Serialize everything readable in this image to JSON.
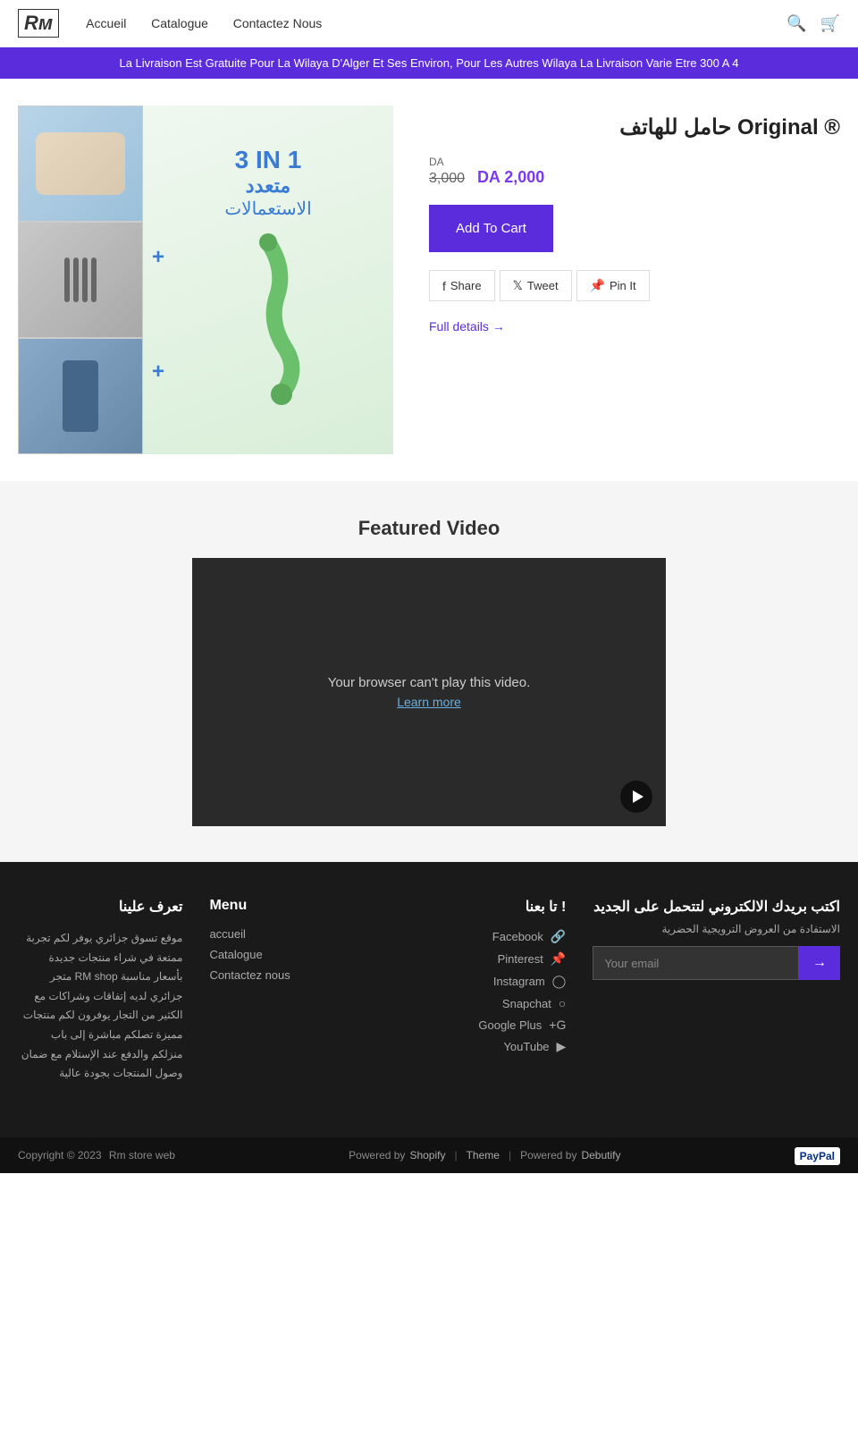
{
  "header": {
    "logo": "Rм",
    "nav": [
      {
        "label": "Accueil",
        "href": "#"
      },
      {
        "label": "Catalogue",
        "href": "#"
      },
      {
        "label": "Contactez Nous",
        "href": "#"
      }
    ]
  },
  "announcement": {
    "text": "La Livraison Est Gratuite Pour La Wilaya D'Alger Et Ses Environ, Pour Les Autres Wilaya La Livraison Varie Etre 300 A 4"
  },
  "product": {
    "title": "® Original حامل للهاتف",
    "currency_label": "DA",
    "original_price": "3,000",
    "sale_price": "DA 2,000",
    "add_to_cart_label": "Add To Cart",
    "full_details_label": "Full details →",
    "share_label": "Share",
    "tweet_label": "Tweet",
    "pin_label": "Pin It",
    "image_text_3in1": "3 IN 1",
    "image_text_arabic1": "متعدد",
    "image_text_arabic2": "الاستعمالات"
  },
  "featured_video": {
    "section_title": "Featured Video",
    "browser_message": "Your browser can't play this video.",
    "learn_more_label": "Learn more"
  },
  "footer": {
    "col1": {
      "title": "تعرف علينا",
      "text": "موقع تسوق جزائري يوفر لكم تجربة ممتعة في شراء منتجات جديدة بأسعار مناسبة RM shop متجر جزائري لديه إتفاقات وشراكات مع الكثير من التجار يوفرون لكم منتجات مميزة تصلكم مباشرة إلى باب منزلكم والدفع عند الإستلام مع ضمان وصول المنتجات بجودة عالية"
    },
    "col2": {
      "title": "Menu",
      "links": [
        "accueil",
        "Catalogue",
        "Contactez nous"
      ]
    },
    "col3": {
      "title": "! تا بعنا",
      "social": [
        {
          "icon": "f",
          "label": "Facebook"
        },
        {
          "icon": "p",
          "label": "Pinterest"
        },
        {
          "icon": "ig",
          "label": "Instagram"
        },
        {
          "icon": "sc",
          "label": "Snapchat"
        },
        {
          "icon": "g+",
          "label": "Google Plus"
        },
        {
          "icon": "yt",
          "label": "YouTube"
        }
      ]
    },
    "col4": {
      "newsletter_title": "اكتب بريدك الالكتروني لتتحمل على الجديد",
      "newsletter_subtitle": "الاستفادة من العروض الترويجية الحضرية",
      "input_placeholder": "Your email",
      "submit_label": "→"
    }
  },
  "footer_bottom": {
    "copyright": "Copyright © 2023",
    "store_name": "Rm store web",
    "powered_by": "Powered by",
    "shopify_label": "Shopify",
    "separator1": "|",
    "theme_label": "Theme",
    "separator2": "|",
    "powered_by2": "Powered by",
    "debutify_label": "Debutify",
    "payment_badge": "PayPal"
  }
}
